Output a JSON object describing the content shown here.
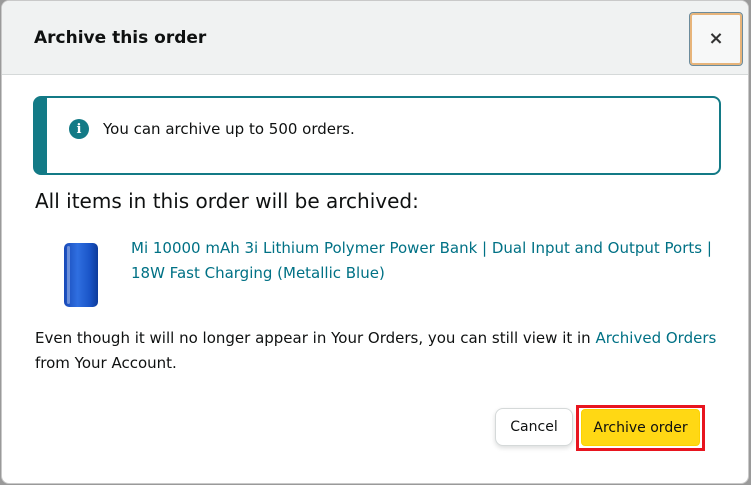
{
  "dialog": {
    "title": "Archive this order",
    "close_label": "×"
  },
  "alert": {
    "icon": "info-icon",
    "icon_glyph": "i",
    "text": "You can archive up to 500 orders."
  },
  "items_heading": "All items in this order will be archived:",
  "product": {
    "image": "power-bank-image",
    "title": "Mi 10000 mAh 3i Lithium Polymer Power Bank | Dual Input and Output Ports | 18W Fast Charging (Metallic Blue)"
  },
  "info": {
    "text_before": "Even though it will no longer appear in Your Orders, you can still view it in ",
    "link_label": "Archived Orders",
    "text_after": " from Your Account."
  },
  "buttons": {
    "cancel_label": "Cancel",
    "archive_label": "Archive order"
  },
  "colors": {
    "accent": "#137a86",
    "link": "#007185",
    "primary_button": "#ffd814",
    "highlight": "#e8151f"
  }
}
